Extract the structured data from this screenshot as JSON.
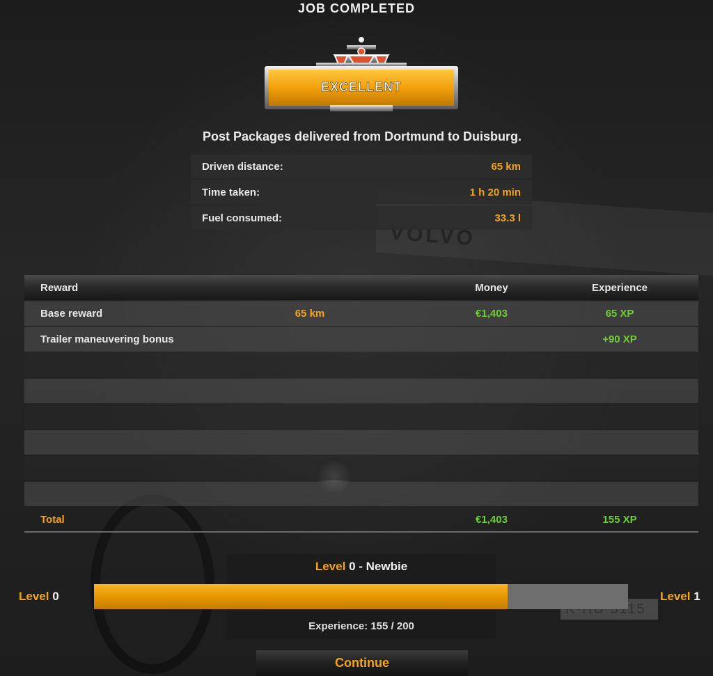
{
  "header": {
    "title": "JOB COMPLETED"
  },
  "rating": {
    "label": "EXCELLENT"
  },
  "summary": "Post Packages delivered from Dortmund to Duisburg.",
  "stats": [
    {
      "label": "Driven distance:",
      "value": "65 km"
    },
    {
      "label": "Time taken:",
      "value": "1 h 20 min"
    },
    {
      "label": "Fuel consumed:",
      "value": "33.3 l"
    }
  ],
  "rewards": {
    "columns": {
      "reward": "Reward",
      "money": "Money",
      "experience": "Experience"
    },
    "rows": [
      {
        "name": "Base reward",
        "distance": "65 km",
        "money": "€1,403",
        "xp": "65 XP"
      },
      {
        "name": "Trailer maneuvering bonus",
        "distance": "",
        "money": "",
        "xp": "+90 XP"
      }
    ],
    "total": {
      "label": "Total",
      "money": "€1,403",
      "xp": "155 XP"
    }
  },
  "level": {
    "title_level_word": "Level",
    "title_level_number": "0",
    "title_rank": " - Newbie",
    "left_word": "Level",
    "left_number": "0",
    "right_word": "Level",
    "right_number": "1",
    "progress_fraction": 0.775,
    "experience_text": "Experience: 155 / 200"
  },
  "continue_label": "Continue",
  "background": {
    "plate_text": "K·HU 3115"
  },
  "colors": {
    "accent": "#f4a51c",
    "positive": "#6fcf35",
    "bar_empty": "#6e6e6e"
  }
}
